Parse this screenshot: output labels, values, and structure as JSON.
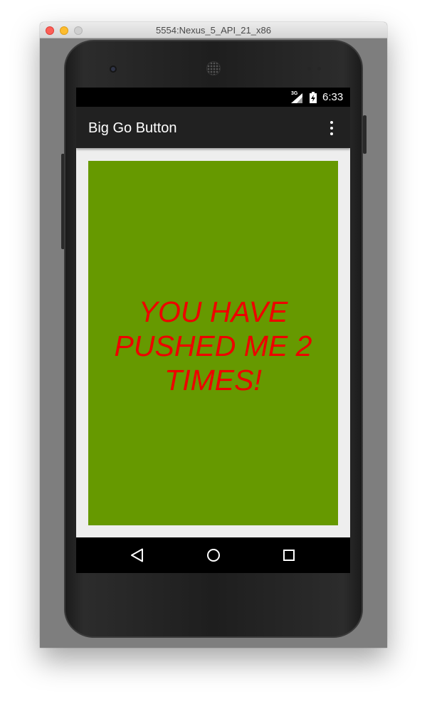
{
  "window": {
    "title": "5554:Nexus_5_API_21_x86"
  },
  "statusbar": {
    "network": "3G",
    "time": "6:33"
  },
  "appbar": {
    "title": "Big Go Button"
  },
  "main": {
    "button_text": "YOU HAVE PUSHED ME 2 TIMES!"
  },
  "colors": {
    "button_bg": "#669900",
    "button_text": "#ee0000",
    "appbar_bg": "#212121",
    "content_bg": "#eeeeee"
  },
  "icons": {
    "overflow": "more-vert-icon",
    "signal": "signal-icon",
    "battery": "battery-icon",
    "back": "back-icon",
    "home": "home-icon",
    "recents": "recents-icon"
  }
}
